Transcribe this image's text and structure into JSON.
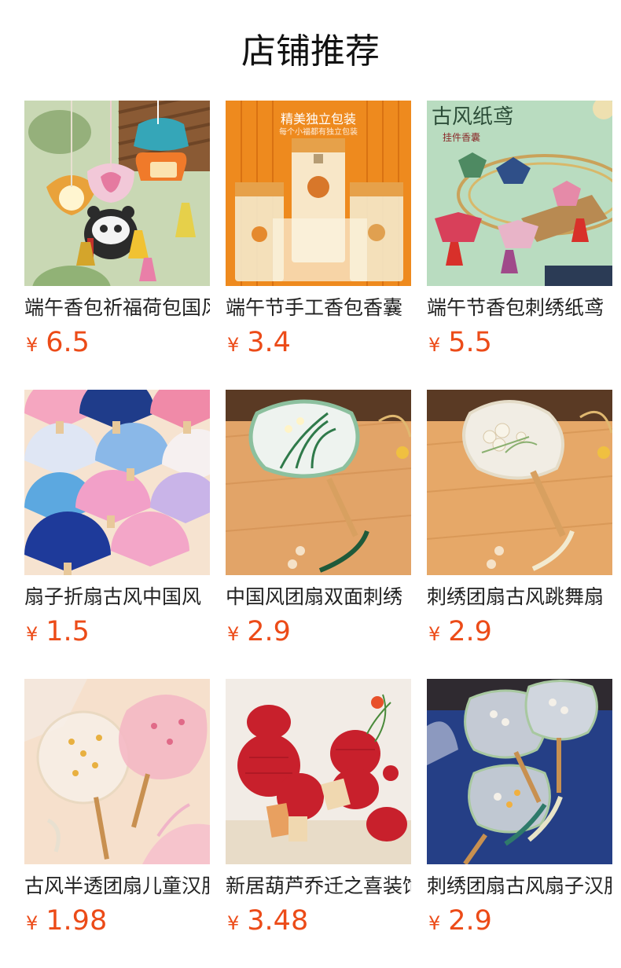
{
  "header": {
    "title": "店铺推荐"
  },
  "currency_symbol": "¥",
  "colors": {
    "price": "#ec4b18",
    "title": "#111111",
    "name": "#222222"
  },
  "products": [
    {
      "name": "端午香包祈福荷包国风",
      "price": "6.5",
      "image": "sachet-panda-lotus"
    },
    {
      "name": "端午节手工香包香囊",
      "price": "3.4",
      "image": "boxed-sachets",
      "image_text": {
        "headline": "精美独立包装",
        "sub": "每个小福都有独立包装"
      }
    },
    {
      "name": "端午节香包刺绣纸鸢",
      "price": "5.5",
      "image": "kite-sachets",
      "image_text": {
        "brand": "古风纸鸢",
        "sub": "挂件香囊"
      }
    },
    {
      "name": "扇子折扇古风中国风",
      "price": "1.5",
      "image": "folding-fans"
    },
    {
      "name": "中国风团扇双面刺绣",
      "price": "2.9",
      "image": "orchid-round-fan"
    },
    {
      "name": "刺绣团扇古风跳舞扇",
      "price": "2.9",
      "image": "flower-round-fan"
    },
    {
      "name": "古风半透团扇儿童汉服",
      "price": "1.98",
      "image": "translucent-fans"
    },
    {
      "name": "新居葫芦乔迁之喜装饰",
      "price": "3.48",
      "image": "gourd-decor"
    },
    {
      "name": "刺绣团扇古风扇子汉服",
      "price": "2.9",
      "image": "blue-embroidered-fans"
    }
  ]
}
